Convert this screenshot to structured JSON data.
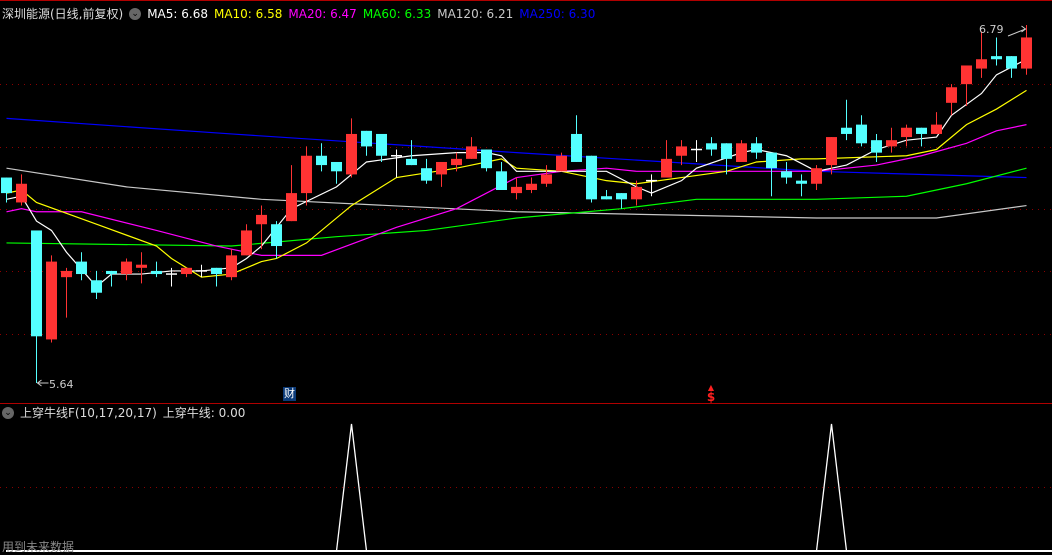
{
  "header": {
    "title": "深圳能源(日线,前复权)",
    "ma": [
      {
        "label": "MA5: 6.68",
        "color": "#ffffff"
      },
      {
        "label": "MA10: 6.58",
        "color": "#ffff00"
      },
      {
        "label": "MA20: 6.47",
        "color": "#ff00ff"
      },
      {
        "label": "MA60: 6.33",
        "color": "#00ff00"
      },
      {
        "label": "MA120: 6.21",
        "color": "#c8c8c8"
      },
      {
        "label": "MA250: 6.30",
        "color": "#0000ff"
      }
    ]
  },
  "annotations": {
    "high_label": "6.79",
    "low_label": "5.64",
    "finance_marker": "财",
    "dividend_marker": "$",
    "future_data_note": "用到未来数据"
  },
  "indicator": {
    "title": "上穿牛线F(10,17,20,17)",
    "value_label": "上穿牛线: 0.00"
  },
  "colors": {
    "up": "#ff3333",
    "down": "#54ffff",
    "flat": "#ffffff",
    "grid": "#8b0000"
  },
  "chart_data": {
    "type": "candlestick",
    "title": "深圳能源(日线,前复权)",
    "ylim": [
      5.64,
      6.79
    ],
    "ohlc": [
      [
        6.3,
        6.3,
        6.22,
        6.25
      ],
      [
        6.22,
        6.31,
        6.21,
        6.28
      ],
      [
        6.13,
        6.13,
        5.64,
        5.79
      ],
      [
        5.78,
        6.05,
        5.77,
        6.03
      ],
      [
        5.98,
        6.01,
        5.85,
        6.0
      ],
      [
        6.03,
        6.06,
        5.97,
        5.99
      ],
      [
        5.97,
        6.0,
        5.91,
        5.93
      ],
      [
        6.0,
        6.0,
        5.95,
        5.99
      ],
      [
        5.99,
        6.04,
        5.97,
        6.03
      ],
      [
        6.01,
        6.06,
        5.96,
        6.02
      ],
      [
        6.0,
        6.03,
        5.98,
        5.99
      ],
      [
        5.99,
        6.01,
        5.95,
        5.99
      ],
      [
        5.99,
        6.01,
        5.98,
        6.01
      ],
      [
        6.0,
        6.02,
        5.98,
        6.0
      ],
      [
        6.01,
        6.01,
        5.95,
        5.99
      ],
      [
        5.98,
        6.07,
        5.97,
        6.05
      ],
      [
        6.05,
        6.15,
        6.05,
        6.13
      ],
      [
        6.15,
        6.21,
        6.07,
        6.18
      ],
      [
        6.15,
        6.16,
        6.04,
        6.08
      ],
      [
        6.16,
        6.34,
        6.16,
        6.25
      ],
      [
        6.25,
        6.4,
        6.21,
        6.37
      ],
      [
        6.37,
        6.41,
        6.32,
        6.34
      ],
      [
        6.35,
        6.35,
        6.28,
        6.32
      ],
      [
        6.31,
        6.49,
        6.3,
        6.44
      ],
      [
        6.45,
        6.45,
        6.37,
        6.4
      ],
      [
        6.44,
        6.44,
        6.35,
        6.37
      ],
      [
        6.37,
        6.39,
        6.3,
        6.37
      ],
      [
        6.36,
        6.42,
        6.34,
        6.34
      ],
      [
        6.33,
        6.36,
        6.28,
        6.29
      ],
      [
        6.31,
        6.35,
        6.27,
        6.35
      ],
      [
        6.34,
        6.38,
        6.32,
        6.36
      ],
      [
        6.36,
        6.43,
        6.36,
        6.4
      ],
      [
        6.39,
        6.39,
        6.32,
        6.33
      ],
      [
        6.32,
        6.35,
        6.26,
        6.26
      ],
      [
        6.25,
        6.3,
        6.23,
        6.27
      ],
      [
        6.26,
        6.3,
        6.25,
        6.28
      ],
      [
        6.28,
        6.34,
        6.27,
        6.31
      ],
      [
        6.32,
        6.38,
        6.32,
        6.37
      ],
      [
        6.44,
        6.5,
        6.35,
        6.35
      ],
      [
        6.37,
        6.37,
        6.22,
        6.23
      ],
      [
        6.24,
        6.26,
        6.23,
        6.23
      ],
      [
        6.25,
        6.25,
        6.2,
        6.23
      ],
      [
        6.23,
        6.29,
        6.21,
        6.27
      ],
      [
        6.29,
        6.31,
        6.24,
        6.29
      ],
      [
        6.3,
        6.42,
        6.3,
        6.36
      ],
      [
        6.37,
        6.42,
        6.34,
        6.4
      ],
      [
        6.39,
        6.42,
        6.35,
        6.39
      ],
      [
        6.41,
        6.43,
        6.37,
        6.39
      ],
      [
        6.41,
        6.41,
        6.31,
        6.36
      ],
      [
        6.35,
        6.42,
        6.35,
        6.41
      ],
      [
        6.41,
        6.43,
        6.36,
        6.38
      ],
      [
        6.38,
        6.38,
        6.24,
        6.33
      ],
      [
        6.32,
        6.35,
        6.28,
        6.3
      ],
      [
        6.29,
        6.31,
        6.24,
        6.28
      ],
      [
        6.28,
        6.34,
        6.26,
        6.33
      ],
      [
        6.34,
        6.43,
        6.31,
        6.43
      ],
      [
        6.46,
        6.55,
        6.42,
        6.44
      ],
      [
        6.47,
        6.5,
        6.4,
        6.41
      ],
      [
        6.42,
        6.44,
        6.35,
        6.38
      ],
      [
        6.4,
        6.46,
        6.38,
        6.42
      ],
      [
        6.43,
        6.47,
        6.4,
        6.46
      ],
      [
        6.46,
        6.46,
        6.4,
        6.44
      ],
      [
        6.44,
        6.51,
        6.44,
        6.47
      ],
      [
        6.54,
        6.6,
        6.5,
        6.59
      ],
      [
        6.6,
        6.66,
        6.53,
        6.66
      ],
      [
        6.65,
        6.77,
        6.62,
        6.68
      ],
      [
        6.69,
        6.75,
        6.66,
        6.68
      ],
      [
        6.69,
        6.69,
        6.62,
        6.65
      ],
      [
        6.65,
        6.79,
        6.63,
        6.75
      ]
    ],
    "ohlc_order": [
      "open",
      "high",
      "low",
      "close"
    ],
    "ma_series": [
      {
        "name": "MA250",
        "color": "#0000ff",
        "points": [
          [
            0,
            6.49
          ],
          [
            15,
            6.44
          ],
          [
            34,
            6.38
          ],
          [
            54,
            6.32
          ],
          [
            68,
            6.3
          ]
        ]
      },
      {
        "name": "MA120",
        "color": "#c8c8c8",
        "points": [
          [
            0,
            6.33
          ],
          [
            8,
            6.27
          ],
          [
            17,
            6.23
          ],
          [
            34,
            6.19
          ],
          [
            54,
            6.17
          ],
          [
            62,
            6.17
          ],
          [
            68,
            6.21
          ]
        ]
      },
      {
        "name": "MA60",
        "color": "#00ff00",
        "points": [
          [
            0,
            6.09
          ],
          [
            15,
            6.08
          ],
          [
            22,
            6.11
          ],
          [
            28,
            6.13
          ],
          [
            34,
            6.17
          ],
          [
            41,
            6.2
          ],
          [
            46,
            6.23
          ],
          [
            54,
            6.23
          ],
          [
            60,
            6.24
          ],
          [
            64,
            6.28
          ],
          [
            68,
            6.33
          ]
        ]
      },
      {
        "name": "MA20",
        "color": "#ff00ff",
        "points": [
          [
            0,
            6.19
          ],
          [
            1,
            6.2
          ],
          [
            2,
            6.19
          ],
          [
            5,
            6.19
          ],
          [
            10,
            6.13
          ],
          [
            14,
            6.08
          ],
          [
            17,
            6.05
          ],
          [
            21,
            6.05
          ],
          [
            26,
            6.14
          ],
          [
            30,
            6.2
          ],
          [
            34,
            6.3
          ],
          [
            37,
            6.32
          ],
          [
            40,
            6.33
          ],
          [
            42,
            6.32
          ],
          [
            46,
            6.32
          ],
          [
            54,
            6.32
          ],
          [
            58,
            6.34
          ],
          [
            61,
            6.37
          ],
          [
            64,
            6.41
          ],
          [
            66,
            6.45
          ],
          [
            68,
            6.47
          ]
        ]
      },
      {
        "name": "MA10",
        "color": "#ffff00",
        "points": [
          [
            0,
            6.25
          ],
          [
            1,
            6.26
          ],
          [
            2,
            6.22
          ],
          [
            6,
            6.15
          ],
          [
            10,
            6.08
          ],
          [
            11,
            6.04
          ],
          [
            13,
            5.98
          ],
          [
            15,
            5.99
          ],
          [
            17,
            6.03
          ],
          [
            18,
            6.04
          ],
          [
            20,
            6.09
          ],
          [
            23,
            6.21
          ],
          [
            26,
            6.3
          ],
          [
            30,
            6.33
          ],
          [
            33,
            6.36
          ],
          [
            34,
            6.33
          ],
          [
            37,
            6.32
          ],
          [
            40,
            6.29
          ],
          [
            42,
            6.28
          ],
          [
            45,
            6.3
          ],
          [
            48,
            6.32
          ],
          [
            50,
            6.35
          ],
          [
            53,
            6.36
          ],
          [
            54,
            6.36
          ],
          [
            60,
            6.37
          ],
          [
            62,
            6.39
          ],
          [
            64,
            6.47
          ],
          [
            66,
            6.52
          ],
          [
            68,
            6.58
          ]
        ]
      },
      {
        "name": "MA5",
        "color": "#ffffff",
        "points": [
          [
            0,
            6.23
          ],
          [
            1,
            6.24
          ],
          [
            2,
            6.16
          ],
          [
            3,
            6.13
          ],
          [
            4,
            6.06
          ],
          [
            6,
            5.95
          ],
          [
            7,
            5.99
          ],
          [
            9,
            5.99
          ],
          [
            11,
            6.0
          ],
          [
            13,
            6.0
          ],
          [
            15,
            6.01
          ],
          [
            16,
            6.04
          ],
          [
            17,
            6.08
          ],
          [
            19,
            6.2
          ],
          [
            22,
            6.27
          ],
          [
            23,
            6.31
          ],
          [
            24,
            6.35
          ],
          [
            27,
            6.37
          ],
          [
            30,
            6.38
          ],
          [
            32,
            6.38
          ],
          [
            33,
            6.37
          ],
          [
            34,
            6.32
          ],
          [
            37,
            6.32
          ],
          [
            40,
            6.32
          ],
          [
            42,
            6.27
          ],
          [
            43,
            6.25
          ],
          [
            45,
            6.29
          ],
          [
            46,
            6.33
          ],
          [
            49,
            6.38
          ],
          [
            50,
            6.39
          ],
          [
            52,
            6.37
          ],
          [
            54,
            6.32
          ],
          [
            56,
            6.34
          ],
          [
            58,
            6.39
          ],
          [
            60,
            6.42
          ],
          [
            62,
            6.43
          ],
          [
            63,
            6.5
          ],
          [
            65,
            6.57
          ],
          [
            66,
            6.63
          ],
          [
            68,
            6.68
          ]
        ]
      }
    ],
    "indicator_values": {
      "name": "上穿牛线",
      "ylim": [
        0,
        1
      ],
      "nonzero": [
        [
          23,
          1
        ],
        [
          55,
          1
        ]
      ]
    },
    "high_marker_index": 68,
    "low_marker_index": 2
  }
}
